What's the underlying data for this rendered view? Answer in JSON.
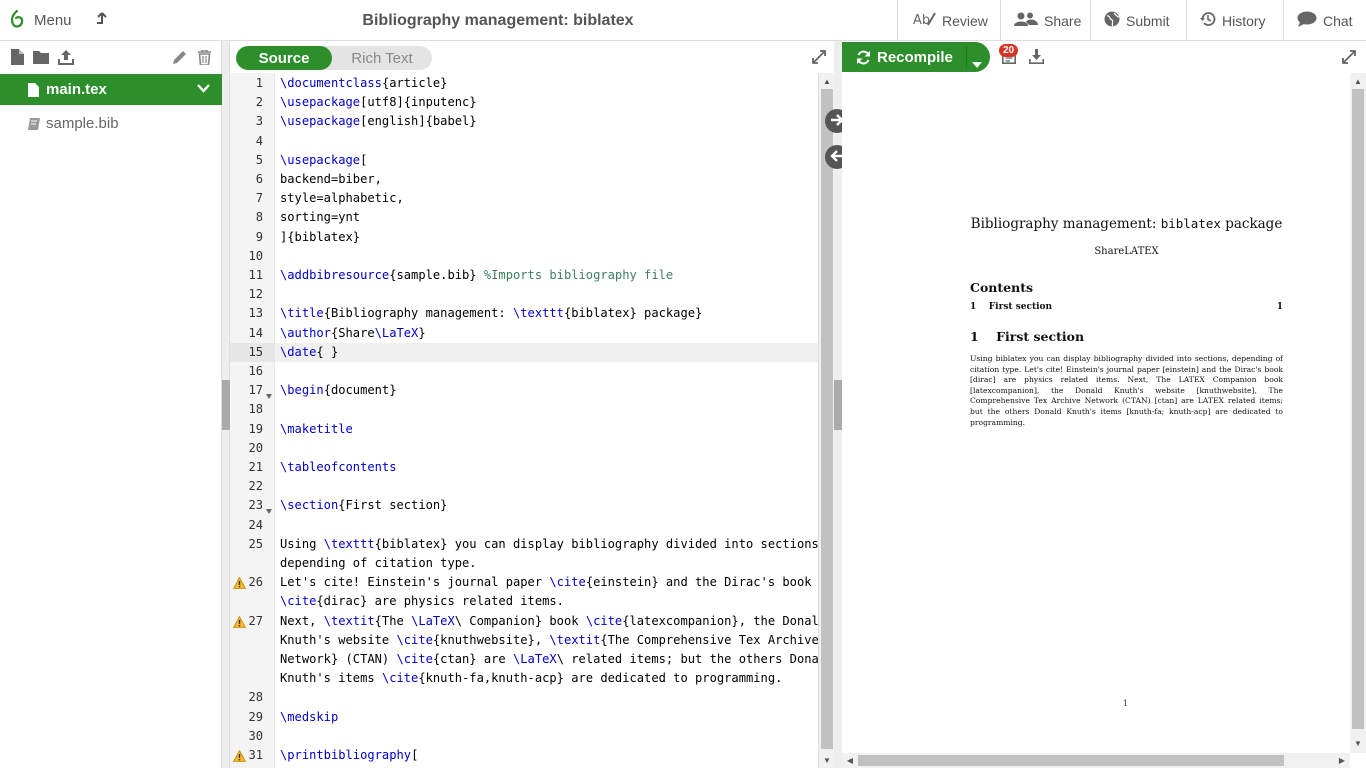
{
  "topbar": {
    "menu_label": "Menu",
    "project_title": "Bibliography management: biblatex",
    "review_label": "Review",
    "share_label": "Share",
    "submit_label": "Submit",
    "history_label": "History",
    "chat_label": "Chat"
  },
  "file_tree": {
    "files": [
      {
        "name": "main.tex",
        "selected": true
      },
      {
        "name": "sample.bib",
        "selected": false
      }
    ]
  },
  "editor": {
    "source_label": "Source",
    "rich_text_label": "Rich Text",
    "active_line": 15,
    "line_numbers": [
      "1",
      "2",
      "3",
      "4",
      "5",
      "6",
      "7",
      "8",
      "9",
      "10",
      "11",
      "12",
      "13",
      "14",
      "15",
      "16",
      "17",
      "18",
      "19",
      "20",
      "21",
      "22",
      "23",
      "24",
      "25",
      "26",
      "27",
      "28",
      "29",
      "30",
      "31"
    ],
    "warning_lines": [
      26,
      27,
      31
    ],
    "fold_lines": [
      17,
      23
    ],
    "lines": [
      "\\documentclass{article}",
      "\\usepackage[utf8]{inputenc}",
      "\\usepackage[english]{babel}",
      "",
      "\\usepackage[",
      "backend=biber,",
      "style=alphabetic,",
      "sorting=ynt",
      "]{biblatex}",
      "",
      "\\addbibresource{sample.bib} %Imports bibliography file",
      "",
      "\\title{Bibliography management: \\texttt{biblatex} package}",
      "\\author{Share\\LaTeX}",
      "\\date{ }",
      "",
      "\\begin{document}",
      "",
      "\\maketitle",
      "",
      "\\tableofcontents",
      "",
      "\\section{First section}",
      "",
      "Using \\texttt{biblatex} you can display bibliography divided into sections,",
      "depending of citation type.",
      "Let's cite! Einstein's journal paper \\cite{einstein} and the Dirac's book",
      "\\cite{dirac} are physics related items.",
      "Next, \\textit{The \\LaTeX\\ Companion} book \\cite{latexcompanion}, the Donald",
      "Knuth's website \\cite{knuthwebsite}, \\textit{The Comprehensive Tex Archive",
      "Network} (CTAN) \\cite{ctan} are \\LaTeX\\ related items; but the others Donald",
      "Knuth's items \\cite{knuth-fa,knuth-acp} are dedicated to programming.",
      "",
      "\\medskip",
      "",
      "\\printbibliography["
    ]
  },
  "pdf": {
    "recompile_label": "Recompile",
    "log_count": "20",
    "title_pre": "Bibliography management: ",
    "title_tt": "biblatex",
    "title_post": " package",
    "author": "ShareLATEX",
    "contents_heading": "Contents",
    "toc_entry": "1    First section",
    "toc_page": "1",
    "section_heading": "1    First section",
    "body": "Using biblatex you can display bibliography divided into sections, depending of citation type. Let's cite! Einstein's journal paper [einstein] and the Dirac's book [dirac] are physics related items. Next, The LATEX Companion book [latexcompanion], the Donald Knuth's website [knuthwebsite], The Comprehensive Tex Archive Network (CTAN) [ctan] are LATEX related items; but the others Donald Knuth's items [knuth-fa; knuth-acp] are dedicated to programming.",
    "page_number": "1"
  },
  "colors": {
    "brand_green": "#2c8f2c",
    "badge_red": "#dd3322"
  }
}
